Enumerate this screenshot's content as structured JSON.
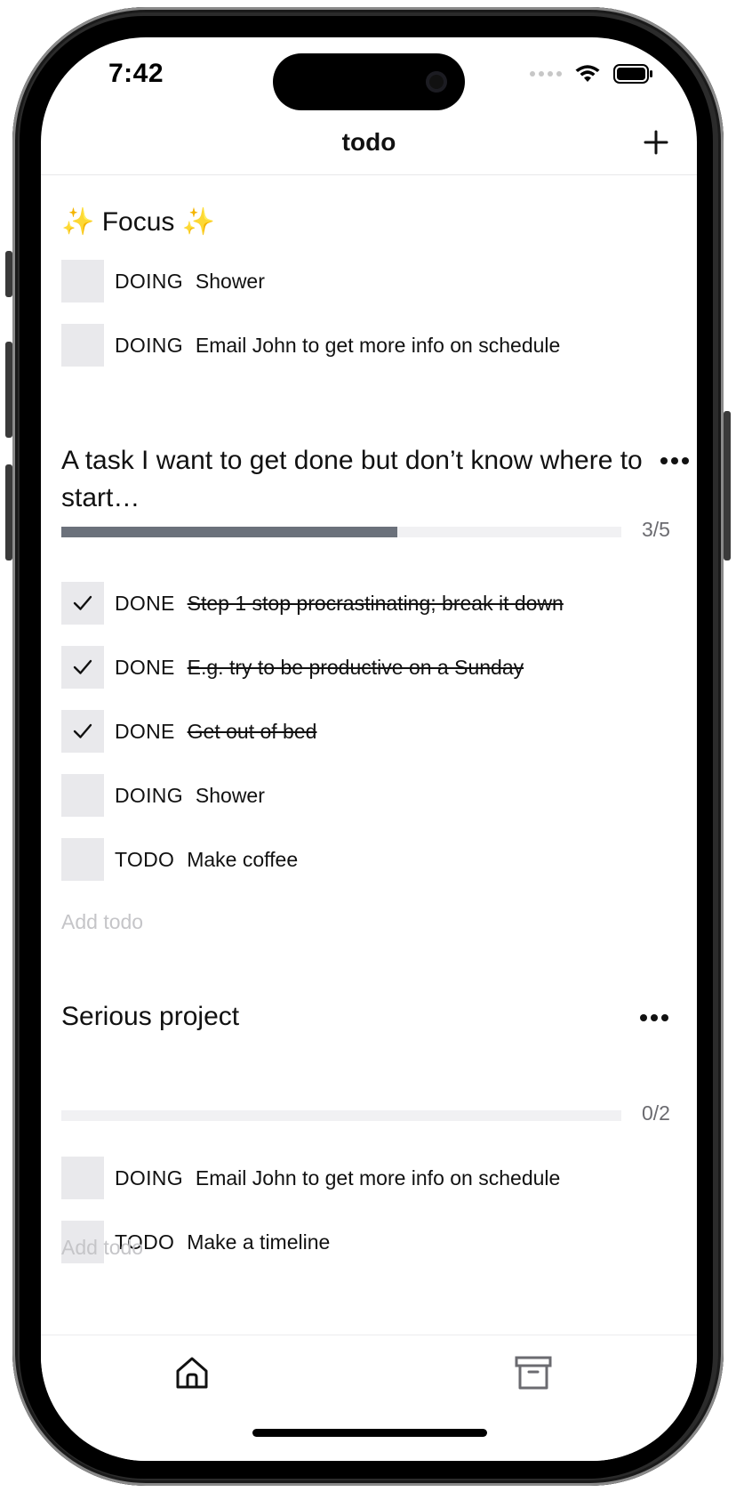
{
  "status_bar": {
    "time": "7:42"
  },
  "nav": {
    "title": "todo",
    "add_icon": "plus-icon"
  },
  "focus": {
    "title": "✨ Focus ✨",
    "items": [
      {
        "status": "DOING",
        "text": "Shower",
        "done": false
      },
      {
        "status": "DOING",
        "text": "Email John to get more info on schedule",
        "done": false
      }
    ]
  },
  "projects": [
    {
      "title": "A task I want to get done but don’t know where to start…",
      "progress": 0.6,
      "progress_label": "3/5",
      "items": [
        {
          "status": "DONE",
          "text": "Step 1 stop procrastinating; break it down",
          "done": true
        },
        {
          "status": "DONE",
          "text": "E.g. try to be productive on a Sunday",
          "done": true
        },
        {
          "status": "DONE",
          "text": "Get out of bed",
          "done": true
        },
        {
          "status": "DOING",
          "text": "Shower",
          "done": false
        },
        {
          "status": "TODO",
          "text": "Make coffee",
          "done": false
        }
      ],
      "add_placeholder": "Add todo"
    },
    {
      "title": "Serious project",
      "progress": 0.0,
      "progress_label": "0/2",
      "items": [
        {
          "status": "DOING",
          "text": "Email John to get more info on schedule",
          "done": false
        },
        {
          "status": "TODO",
          "text": "Make a timeline",
          "done": false
        }
      ],
      "add_placeholder": "Add todo"
    }
  ],
  "tabbar": {
    "home_icon": "home-icon",
    "archive_icon": "archive-icon"
  },
  "colors": {
    "progress_fill": "#6b717b",
    "progress_track": "#f1f1f3",
    "checkbox_bg": "#e9e9ec",
    "placeholder": "#c5c5c8"
  }
}
